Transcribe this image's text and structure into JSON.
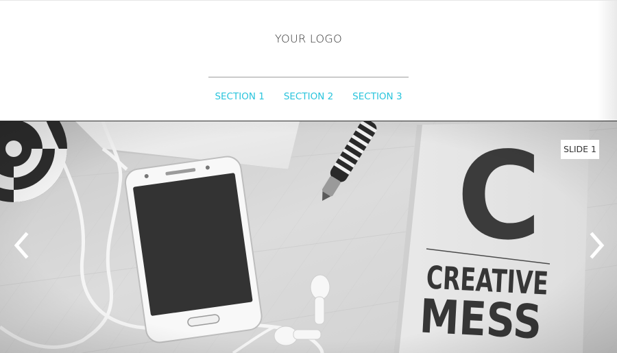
{
  "header": {
    "logo_text": "YOUR LOGO",
    "nav": [
      {
        "label": "SECTION 1"
      },
      {
        "label": "SECTION 2"
      },
      {
        "label": "SECTION 3"
      }
    ],
    "accent_color": "#29c4dc"
  },
  "slider": {
    "badge": "SLIDE 1",
    "prev_icon": "chevron-left-icon",
    "next_icon": "chevron-right-icon",
    "image": {
      "description_icons": [
        "lollipop",
        "smartphone",
        "earphones",
        "pen",
        "notebook"
      ],
      "notebook_letter": "C",
      "notebook_title_line1": "CREATIVE",
      "notebook_title_line2": "MESS"
    }
  }
}
